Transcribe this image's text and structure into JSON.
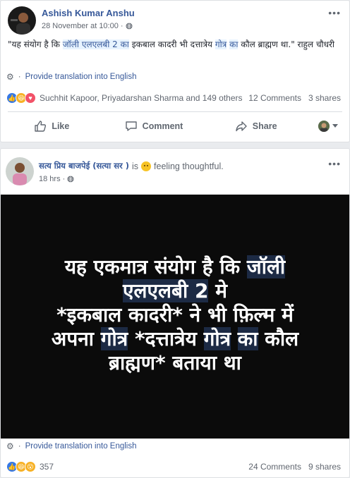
{
  "post1": {
    "author": "Ashish Kumar Anshu",
    "timestamp": "28 November at 10:00",
    "text_parts": [
      {
        "t": "\"यह संयोग है कि ",
        "hl": false
      },
      {
        "t": "जॉली एलएलबी 2 का",
        "hl": true
      },
      {
        "t": " इकबाल कादरी भी दत्तात्रेय ",
        "hl": false
      },
      {
        "t": "गोत्र",
        "hl": true
      },
      {
        "t": " ",
        "hl": false
      },
      {
        "t": "का",
        "hl": true
      },
      {
        "t": " कौल ब्राह्मण था.\" राहुल चौधरी",
        "hl": false
      }
    ],
    "translate_label": "Provide translation into English",
    "reactions_names": "Suchhit Kapoor, Priyadarshan Sharma and 149 others",
    "comments": "12 Comments",
    "shares": "3 shares",
    "actions": {
      "like": "Like",
      "comment": "Comment",
      "share": "Share"
    }
  },
  "post2": {
    "author": "सत्य प्रिय बाजपेई (सत्या सर )",
    "is_word": "is",
    "feeling": "feeling thoughtful.",
    "timestamp": "18 hrs",
    "image_lines": [
      [
        {
          "t": "यह एकमात्र संयोग है कि ",
          "hl": false
        },
        {
          "t": "जॉली",
          "hl": true
        }
      ],
      [
        {
          "t": "एलएलबी 2",
          "hl": true
        },
        {
          "t": " मे",
          "hl": false
        }
      ],
      [
        {
          "t": "*इकबाल कादरी* ने भी फ़िल्म में",
          "hl": false
        }
      ],
      [
        {
          "t": "अपना ",
          "hl": false
        },
        {
          "t": "गोत्र",
          "hl": true
        },
        {
          "t": " *दत्तात्रेय ",
          "hl": false
        },
        {
          "t": "गोत्र",
          "hl": true
        },
        {
          "t": " ",
          "hl": false
        },
        {
          "t": "का",
          "hl": true
        },
        {
          "t": " कौल",
          "hl": false
        }
      ],
      [
        {
          "t": "ब्राह्मण* बताया था",
          "hl": false
        }
      ]
    ],
    "translate_label": "Provide translation into English",
    "reaction_count": "357",
    "comments": "24 Comments",
    "shares": "9 shares"
  },
  "colors": {
    "link": "#365899",
    "like_blue": "#3578e5",
    "haha_yellow": "#f7b125",
    "love_red": "#f25268",
    "image_bg": "#0b0b0b"
  },
  "icons": [
    "more-icon",
    "gear-icon",
    "globe-icon",
    "like-icon",
    "comment-icon",
    "share-icon",
    "chevron-down-icon",
    "feeling-emoji-icon"
  ]
}
